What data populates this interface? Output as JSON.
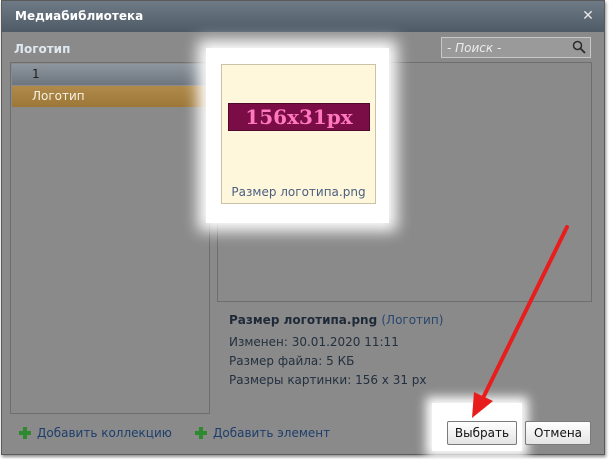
{
  "window": {
    "title": "Медиабиблиотека",
    "close_icon": "close-icon"
  },
  "collections": {
    "label": "Логотип",
    "items": [
      {
        "label": "1"
      },
      {
        "label": "Логотип",
        "selected": true
      }
    ]
  },
  "search": {
    "placeholder": "- Поиск -",
    "icon": "search-icon"
  },
  "media_grid": {
    "items": [
      {
        "logo_text": "156x31px",
        "name": "Размер логотипа.png",
        "selected": true
      }
    ]
  },
  "details": {
    "name": "Размер логотипа.png",
    "collection": "(Логотип)",
    "modified": "Изменен: 30.01.2020 11:11",
    "file_size": "Размер файла: 5 КБ",
    "dimensions": "Размеры картинки: 156 x 31 px"
  },
  "actions": {
    "add_collection": "Добавить коллекцию",
    "add_element": "Добавить элемент",
    "choose": "Выбрать",
    "cancel": "Отмена"
  },
  "colors": {
    "dialog_bg": "#8a8a8a",
    "titlebar": "#5c6874",
    "selected_collection": "#a8823f",
    "logo_bg": "#7a0d45",
    "logo_text": "#ff78c0",
    "annotation_arrow": "#e81d1d"
  }
}
